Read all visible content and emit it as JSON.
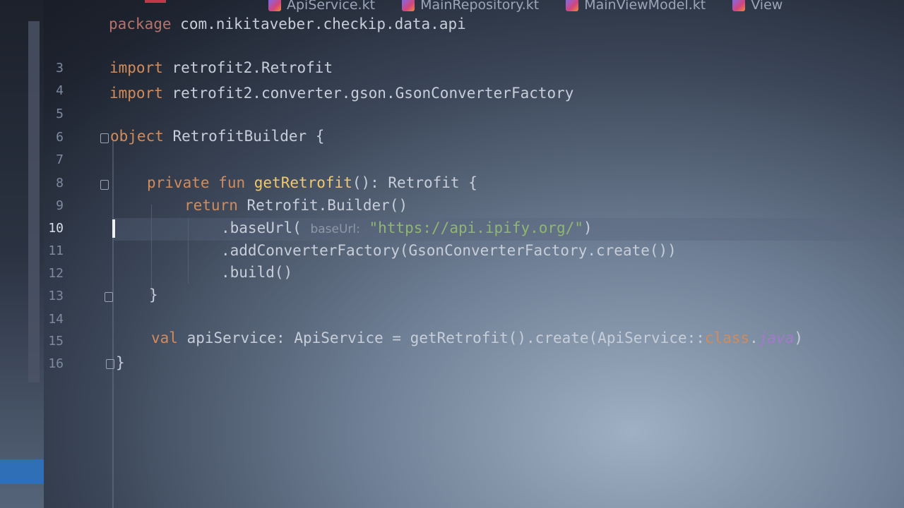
{
  "tabs": [
    {
      "label": "ApiService.kt",
      "visible": "ApiService.kt"
    },
    {
      "label": "MainRepository.kt"
    },
    {
      "label": "MainViewModel.kt"
    },
    {
      "label": "View"
    }
  ],
  "code": {
    "package_kw": "package",
    "package_name": "com.nikitaveber.checkip.data.api",
    "import_kw": "import",
    "import1": "retrofit2.Retrofit",
    "import2": "retrofit2.converter.gson.GsonConverterFactory",
    "object_kw": "object",
    "object_name": "RetrofitBuilder {",
    "private_kw": "private",
    "fun_kw": "fun",
    "fun_name": "getRetrofit",
    "fun_rest": "(): Retrofit {",
    "return_kw": "return",
    "return_rest": "Retrofit.Builder()",
    "baseurl_call": ".baseUrl(",
    "baseurl_hint": "baseUrl:",
    "baseurl_value": "\"https://api.ipify.org/\"",
    "baseurl_close": ")",
    "converter_line": ".addConverterFactory(GsonConverterFactory.create())",
    "build_line": ".build()",
    "close_brace": "}",
    "val_kw": "val",
    "val_name": "apiService",
    "val_rest": ": ApiService = getRetrofit().create(ApiService::",
    "class_kw": "class",
    "dot": ".",
    "java_kw": "java",
    "paren_close": ")",
    "object_close": "}"
  },
  "line_numbers": [
    "3",
    "4",
    "5",
    "6",
    "7",
    "8",
    "9",
    "10",
    "11",
    "12",
    "13",
    "14",
    "15",
    "16"
  ],
  "current_line": "10",
  "colors": {
    "keyword": "#d28b5a",
    "function": "#f1c86a",
    "string": "#8fb76f",
    "text": "#c7ced9",
    "accent_blue": "#2f6fb8"
  }
}
